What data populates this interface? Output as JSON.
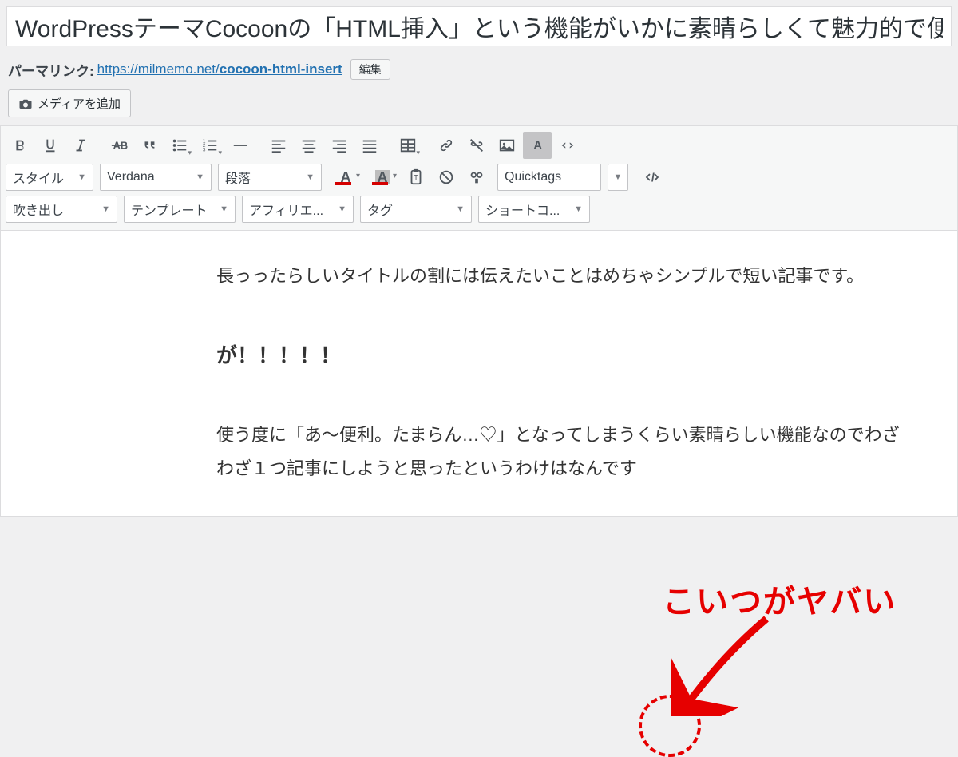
{
  "title": "WordPressテーマCocoonの「HTML挿入」という機能がいかに素晴らしくて魅力的で便利でヤ",
  "permalink": {
    "label": "パーマリンク:",
    "base": "https://milmemo.net/",
    "slug": "cocoon-html-insert",
    "edit": "編集"
  },
  "media_button": "メディアを追加",
  "toolbar": {
    "row2": {
      "style": "スタイル",
      "font": "Verdana",
      "paragraph": "段落",
      "quicktags": "Quicktags"
    },
    "row3": {
      "d1": "吹き出し",
      "d2": "テンプレート",
      "d3": "アフィリエ...",
      "d4": "タグ",
      "d5": "ショートコ..."
    },
    "colors": {
      "text": "#d40000",
      "bg": "#d40000"
    }
  },
  "content": {
    "p1": "長っったらしいタイトルの割には伝えたいことはめちゃシンプルで短い記事です。",
    "p2": "が！！！！！",
    "p3": "使う度に「あ〜便利。たまらん…♡」となってしまうくらい素晴らしい機能なのでわざわざ１つ記事にしようと思ったというわけはなんです"
  },
  "annotation": {
    "text": "こいつがヤバい"
  }
}
